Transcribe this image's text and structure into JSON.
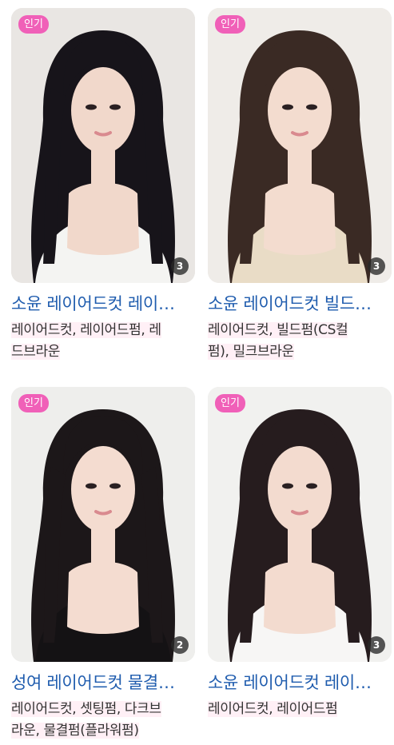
{
  "cards": [
    {
      "badge": "인기",
      "image_count": "3",
      "title": "소윤 레이어드컷 레이어드펌 레드브라운",
      "desc_line1": "레이어드컷, 레이어드펌, 레",
      "desc_line2": "드브라운",
      "photo": "woman-long-black-layered-hair-white-top",
      "colors": {
        "bg": "#e9e6e3",
        "hair": "#17141a",
        "skin": "#f1d8cb",
        "top": "#f4f4f2"
      }
    },
    {
      "badge": "인기",
      "image_count": "3",
      "title": "소윤 레이어드컷 빌드펌 밀크브라운",
      "desc_line1": "레이어드컷, 빌드펌(CS컬",
      "desc_line2": "펌), 밀크브라운",
      "photo": "woman-wavy-brown-hair-knit-top",
      "colors": {
        "bg": "#efece8",
        "hair": "#3a2a24",
        "skin": "#f3dccf",
        "top": "#e9dcc6"
      }
    },
    {
      "badge": "인기",
      "image_count": "2",
      "title": "성여 레이어드컷 물결펌 다크브라운",
      "desc_line1": "레이어드컷, 셋팅펌, 다크브",
      "desc_line2": "라운, 물결펌(플라워펌)",
      "photo": "woman-dark-wavy-hair-black-halter",
      "colors": {
        "bg": "#eeeeec",
        "hair": "#1c1719",
        "skin": "#f4dcd0",
        "top": "#141214"
      }
    },
    {
      "badge": "인기",
      "image_count": "3",
      "title": "소윤 레이어드컷 레이어드펌",
      "desc_line1": "레이어드컷, 레이어드펌",
      "desc_line2": "",
      "photo": "woman-bangs-dark-hair-white-ruffle-top",
      "colors": {
        "bg": "#f1f1ef",
        "hair": "#261c1e",
        "skin": "#f3dbcf",
        "top": "#f7f6f5"
      }
    }
  ]
}
